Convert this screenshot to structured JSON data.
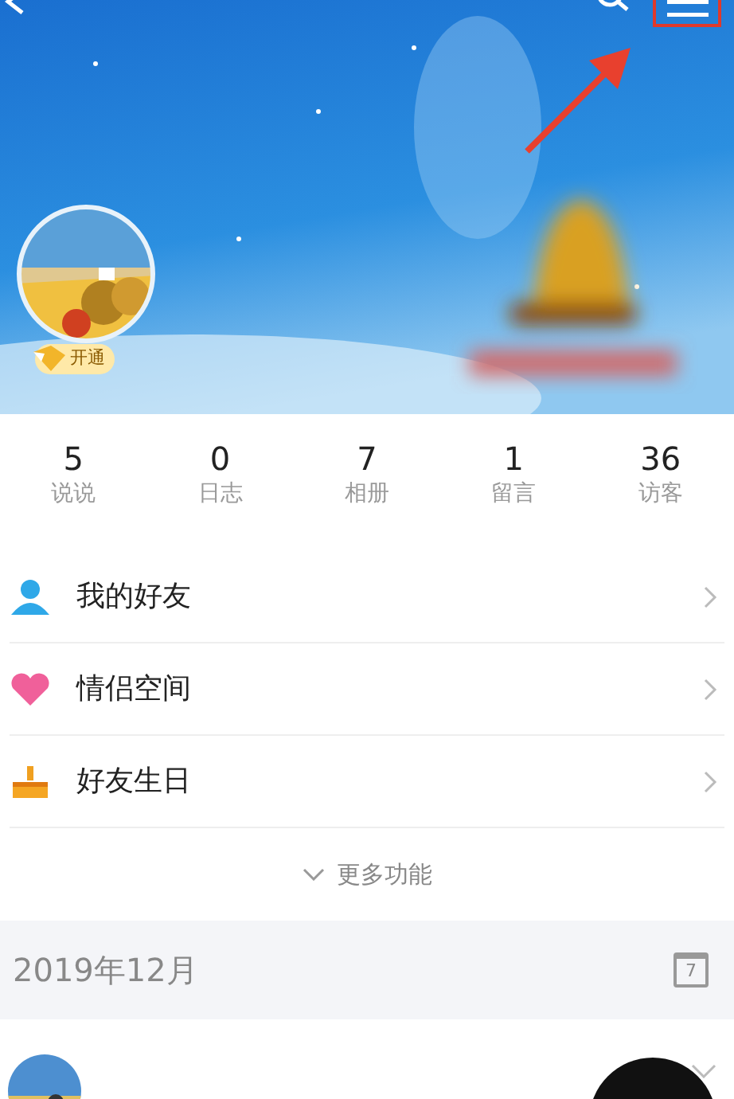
{
  "header": {
    "badge": "开通"
  },
  "stats": [
    {
      "value": "5",
      "label": "说说"
    },
    {
      "value": "0",
      "label": "日志"
    },
    {
      "value": "7",
      "label": "相册"
    },
    {
      "value": "1",
      "label": "留言"
    },
    {
      "value": "36",
      "label": "访客"
    }
  ],
  "menu": [
    {
      "kind": "friends",
      "label": "我的好友"
    },
    {
      "kind": "couple",
      "label": "情侣空间"
    },
    {
      "kind": "birthday",
      "label": "好友生日"
    }
  ],
  "more": {
    "label": "更多功能"
  },
  "timeline": {
    "month": "2019年12月",
    "calendar_day": "7"
  }
}
